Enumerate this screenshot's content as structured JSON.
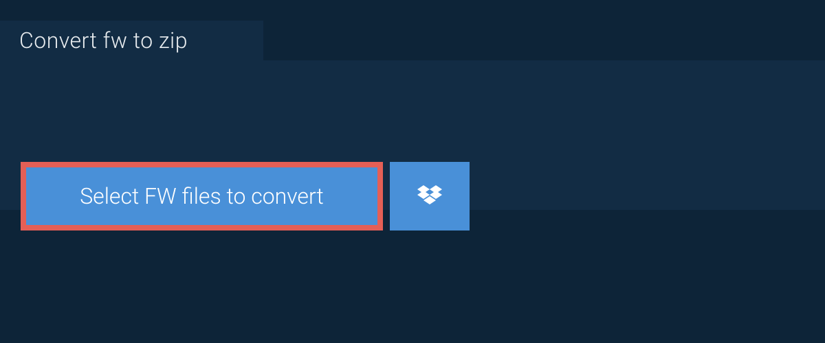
{
  "tab": {
    "label": "Convert fw to zip"
  },
  "buttons": {
    "select_label": "Select FW files to convert"
  },
  "colors": {
    "bg_dark": "#0d2438",
    "bg_panel": "#122c44",
    "accent_blue": "#4990d8",
    "accent_red": "#e45f56"
  }
}
